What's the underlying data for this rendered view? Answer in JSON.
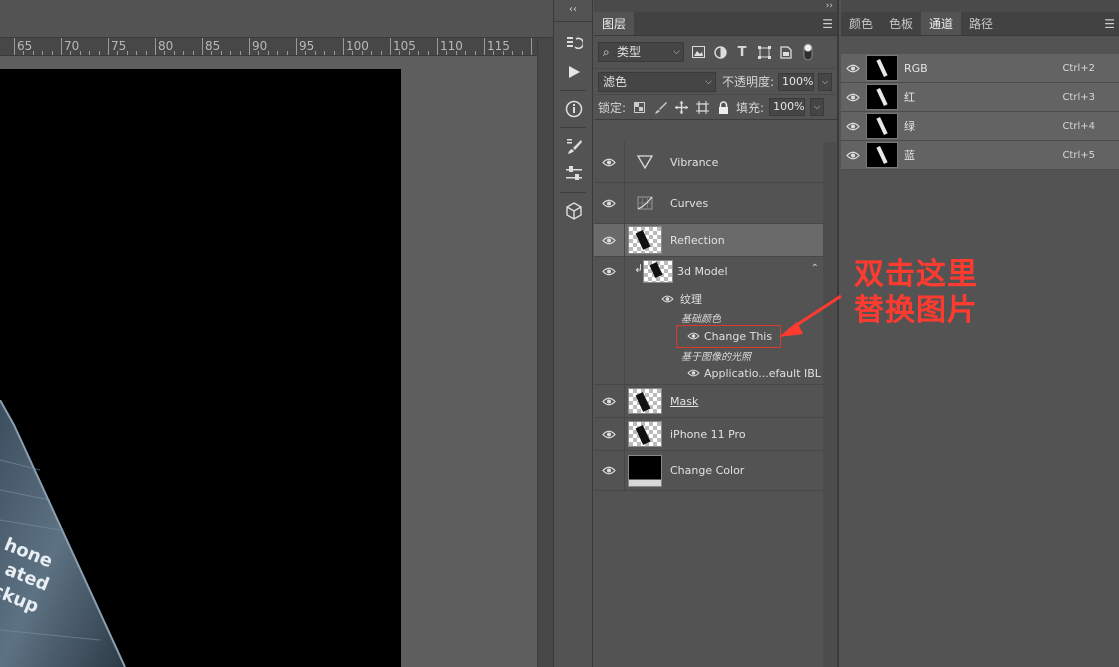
{
  "ruler": {
    "labels": [
      "65",
      "70",
      "75",
      "80",
      "85",
      "90",
      "95",
      "100",
      "105",
      "110",
      "115"
    ]
  },
  "toolstrip": {
    "collapse": "‹‹",
    "icons": [
      "history-icon",
      "play-icon",
      "info-icon",
      "brush-presets-icon",
      "adjustments-icon",
      "3d-icon"
    ]
  },
  "layers_panel": {
    "collapse": "››",
    "tab": "图层",
    "filter": {
      "kind_label": "类型"
    },
    "blend": {
      "mode": "滤色",
      "opacity_label": "不透明度:",
      "opacity_value": "100%"
    },
    "lock": {
      "lock_label": "锁定:",
      "fill_label": "填充:",
      "fill_value": "100%"
    },
    "layers": [
      {
        "name": "Vibrance",
        "icon": "vibrance-icon"
      },
      {
        "name": "Curves",
        "icon": "curves-icon"
      },
      {
        "name": "Reflection",
        "icon": "layer-thumbnail",
        "selected": true
      },
      {
        "name": "3d Model",
        "icon": "3d-layer-thumbnail"
      },
      {
        "name": "Mask",
        "icon": "layer-thumbnail"
      },
      {
        "name": "iPhone 11 Pro",
        "icon": "layer-thumbnail"
      },
      {
        "name": "Change Color",
        "icon": "black-thumbnail"
      }
    ],
    "sublayers": {
      "texture": "纹理",
      "base_color": "基础颜色",
      "change_this": "Change This",
      "ibl": "基于图像的光照",
      "ibl_item": "Applicatio...efault IBL"
    }
  },
  "channels_panel": {
    "tabs": [
      "颜色",
      "色板",
      "通道",
      "路径"
    ],
    "active_tab": "通道",
    "channels": [
      {
        "name": "RGB",
        "shortcut": "Ctrl+2"
      },
      {
        "name": "红",
        "shortcut": "Ctrl+3"
      },
      {
        "name": "绿",
        "shortcut": "Ctrl+4"
      },
      {
        "name": "蓝",
        "shortcut": "Ctrl+5"
      }
    ]
  },
  "annotation": {
    "line1": "双击这里",
    "line2": "替换图片",
    "color": "#ff3b30"
  }
}
